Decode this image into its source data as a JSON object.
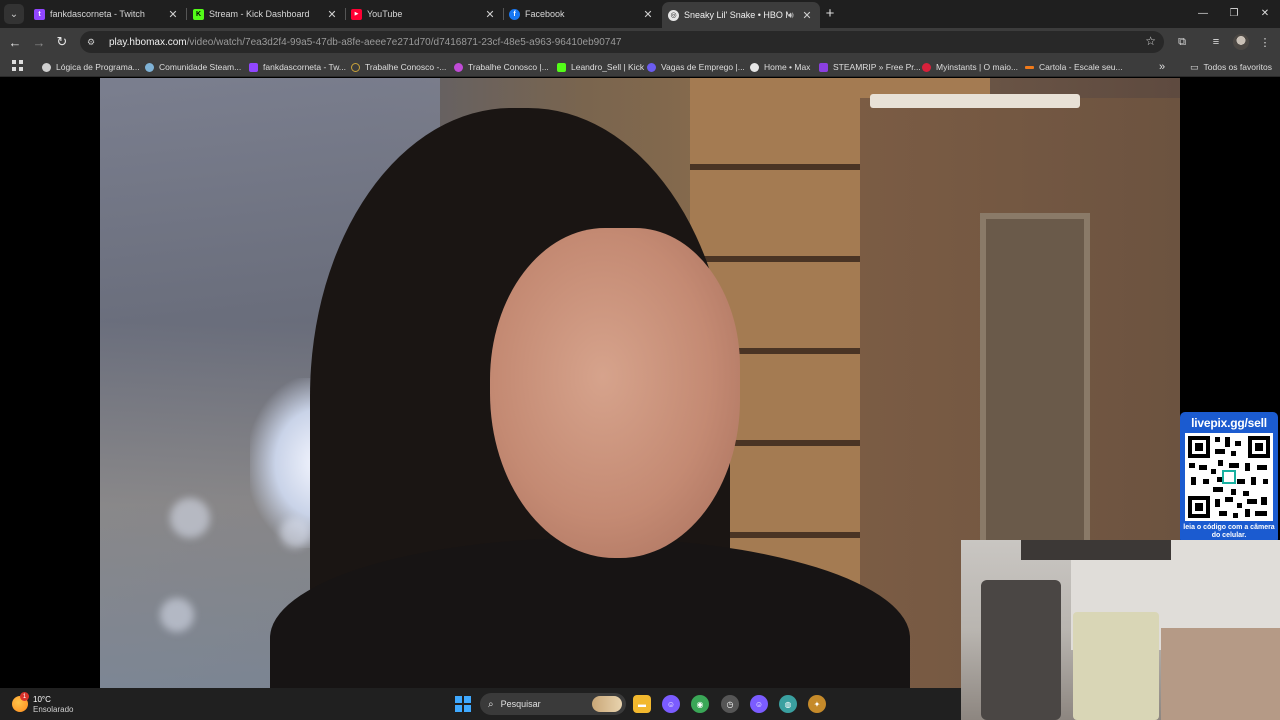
{
  "browser": {
    "tabs": [
      {
        "label": "fankdascorneta - Twitch",
        "favicon": "twitch-icon",
        "color": "#9146ff",
        "glyph": "t"
      },
      {
        "label": "Stream - Kick Dashboard",
        "favicon": "kick-icon",
        "color": "#53fc18",
        "glyph": "K"
      },
      {
        "label": "YouTube",
        "favicon": "youtube-icon",
        "color": "#ff0033",
        "glyph": "▶"
      },
      {
        "label": "Facebook",
        "favicon": "facebook-icon",
        "color": "#1877f2",
        "glyph": "f"
      },
      {
        "label": "Sneaky Lil' Snake • HBO Ma",
        "favicon": "max-icon",
        "color": "#e6e6e6",
        "glyph": "◎",
        "active": true
      }
    ],
    "new_tab_symbol": "+",
    "window_controls": {
      "minimize": "—",
      "maximize": "❐",
      "close": "✕"
    }
  },
  "toolbar": {
    "url_host": "play.hbomax.com",
    "url_path": "/video/watch/7ea3d2f4-99a5-47db-a8fe-aeee7e271d70/d7416871-23cf-48e5-a963-96410eb90747"
  },
  "bookmarks": {
    "items": [
      {
        "label": "Lógica de Programa...",
        "color": "#cfcfcf"
      },
      {
        "label": "Comunidade Steam...",
        "color": "#7fb2d6"
      },
      {
        "label": "fankdascorneta - Tw...",
        "color": "#9146ff"
      },
      {
        "label": "Trabalhe Conosco -...",
        "color": "#c8a23a"
      },
      {
        "label": "Trabalhe Conosco |...",
        "color": "#c04bd6"
      },
      {
        "label": "Leandro_Sell | Kick",
        "color": "#53fc18"
      },
      {
        "label": "Vagas de Emprego |...",
        "color": "#6b5cf0"
      },
      {
        "label": "Home • Max",
        "color": "#e6e6e6"
      },
      {
        "label": "STEAMRIP » Free Pr...",
        "color": "#8b3fe0"
      },
      {
        "label": "Myinstants | O maio...",
        "color": "#d8213b"
      },
      {
        "label": "Cartola - Escale seu...",
        "color": "#f07a1a"
      }
    ],
    "overflow": "»",
    "all_bookmarks": "Todos os favoritos"
  },
  "overlay": {
    "livepix_title": "livepix.gg/sell",
    "livepix_caption": "leia o código com a câmera do celular.",
    "accent": "#1b5bd0"
  },
  "taskbar": {
    "weather_temp": "10°C",
    "weather_condition": "Ensolarado",
    "weather_badge": "1",
    "search_placeholder": "Pesquisar",
    "apps": [
      {
        "name": "file-explorer-icon",
        "color": "#f2b82e",
        "glyph": "▬"
      },
      {
        "name": "messenger-icon",
        "color": "#7b5cff",
        "glyph": "☺"
      },
      {
        "name": "chrome-icon",
        "color": "#3aa757",
        "glyph": "◉"
      },
      {
        "name": "clock-app-icon",
        "color": "#555555",
        "glyph": "◷"
      },
      {
        "name": "messenger-alt-icon",
        "color": "#7b5cff",
        "glyph": "☺"
      },
      {
        "name": "globe-app-icon",
        "color": "#3aa0a0",
        "glyph": "◍"
      },
      {
        "name": "game-app-icon",
        "color": "#c58a2a",
        "glyph": "✦"
      }
    ]
  }
}
